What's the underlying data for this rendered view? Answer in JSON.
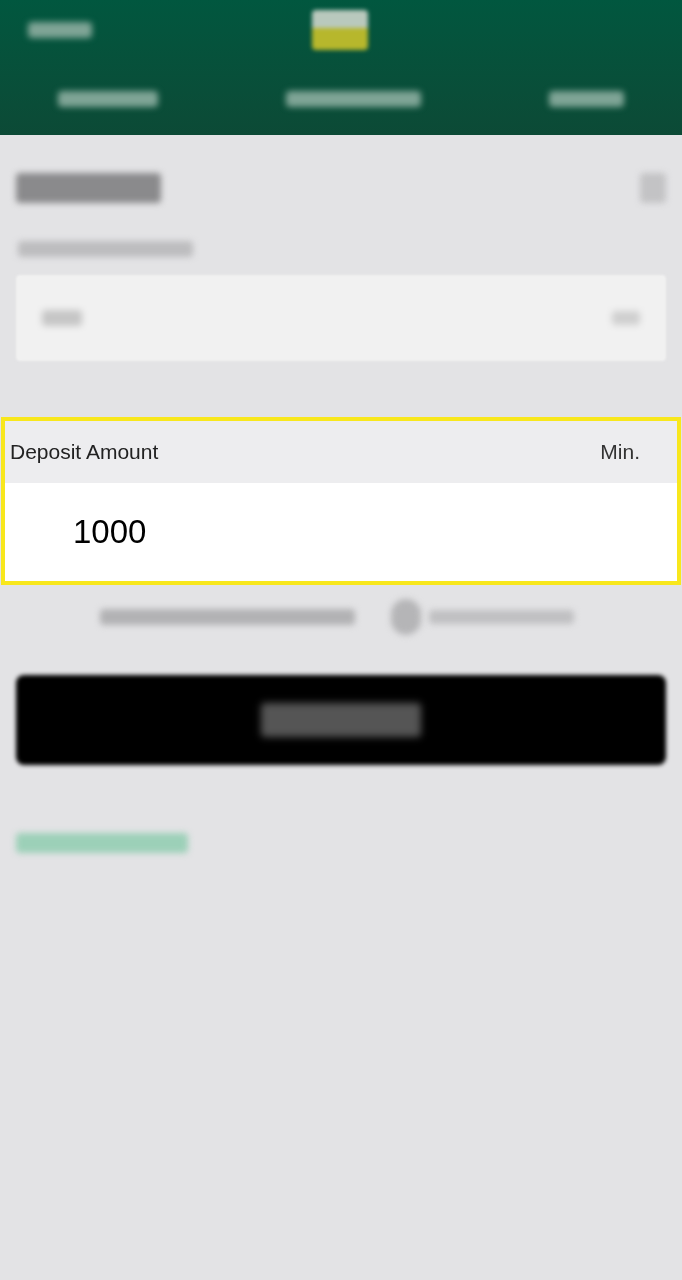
{
  "deposit_amount": {
    "label": "Deposit Amount",
    "hint": "Min.",
    "value": "1000",
    "highlighted": true
  }
}
